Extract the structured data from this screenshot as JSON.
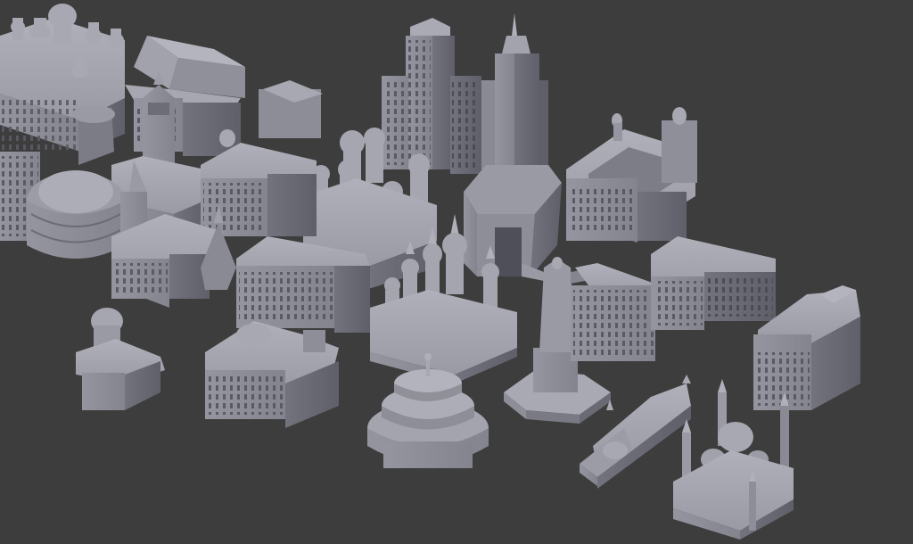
{
  "scene": {
    "background": "#3d3d3d",
    "model_colors": {
      "top": "#a3a3ad",
      "left": "#8a8a95",
      "right": "#6a6a75",
      "shadow": "#55555f"
    },
    "buildings": [
      {
        "name": "domed-palace-group"
      },
      {
        "name": "pagoda-roof-hall"
      },
      {
        "name": "clock-tower-building"
      },
      {
        "name": "rotunda"
      },
      {
        "name": "skyscraper-block"
      },
      {
        "name": "art-deco-tower"
      },
      {
        "name": "courtyard-palace"
      },
      {
        "name": "onion-dome-cathedral"
      },
      {
        "name": "classical-mansion"
      },
      {
        "name": "gothic-church"
      },
      {
        "name": "multi-spire-cathedral"
      },
      {
        "name": "christ-statue"
      },
      {
        "name": "tiered-round-temple"
      },
      {
        "name": "mosque-with-minarets"
      },
      {
        "name": "long-arched-hall"
      },
      {
        "name": "row-houses"
      },
      {
        "name": "theater-building"
      },
      {
        "name": "small-domed-chapel"
      },
      {
        "name": "ornate-palace"
      },
      {
        "name": "terraced-townhouses"
      }
    ]
  }
}
